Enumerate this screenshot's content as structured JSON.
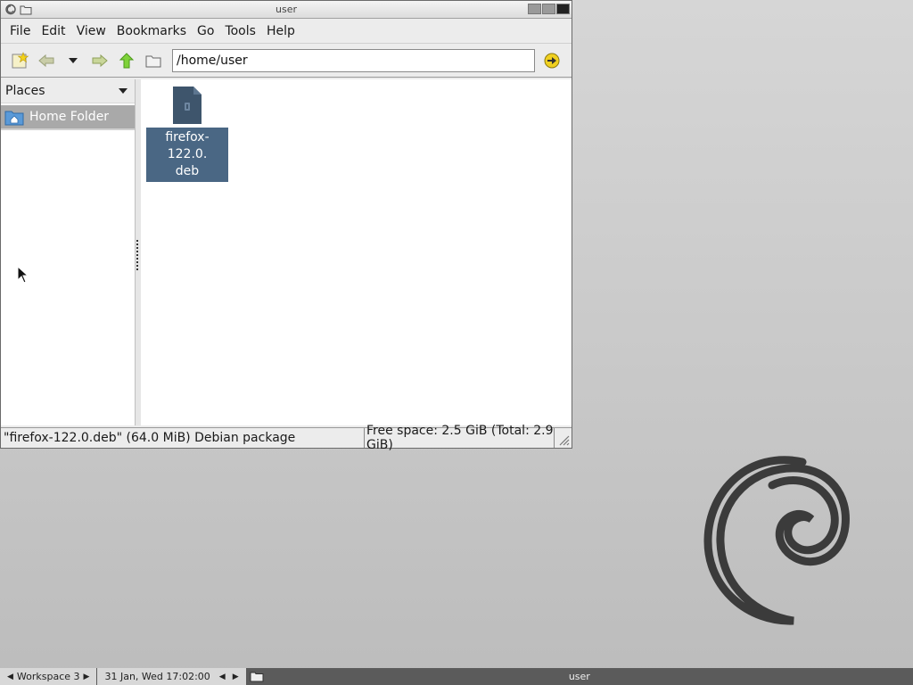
{
  "window": {
    "title": "user"
  },
  "menu": {
    "file": "File",
    "edit": "Edit",
    "view": "View",
    "bookmarks": "Bookmarks",
    "go": "Go",
    "tools": "Tools",
    "help": "Help"
  },
  "toolbar": {
    "location": "/home/user"
  },
  "sidebar": {
    "header": "Places",
    "items": [
      {
        "label": "Home Folder"
      }
    ]
  },
  "files": [
    {
      "name_line1": "firefox-122.0.",
      "name_line2": "deb",
      "icon": "deb-package-icon"
    }
  ],
  "statusbar": {
    "selection": "\"firefox-122.0.deb\" (64.0 MiB) Debian package",
    "free_space": "Free space: 2.5 GiB (Total: 2.9 GiB)"
  },
  "taskbar": {
    "workspace": "Workspace 3",
    "clock": "31 Jan, Wed 17:02:00",
    "window_title": "user"
  },
  "colors": {
    "selection": "#4a6784",
    "desktop": "#c7c7c7",
    "taskbar": "#5b5b5b"
  }
}
